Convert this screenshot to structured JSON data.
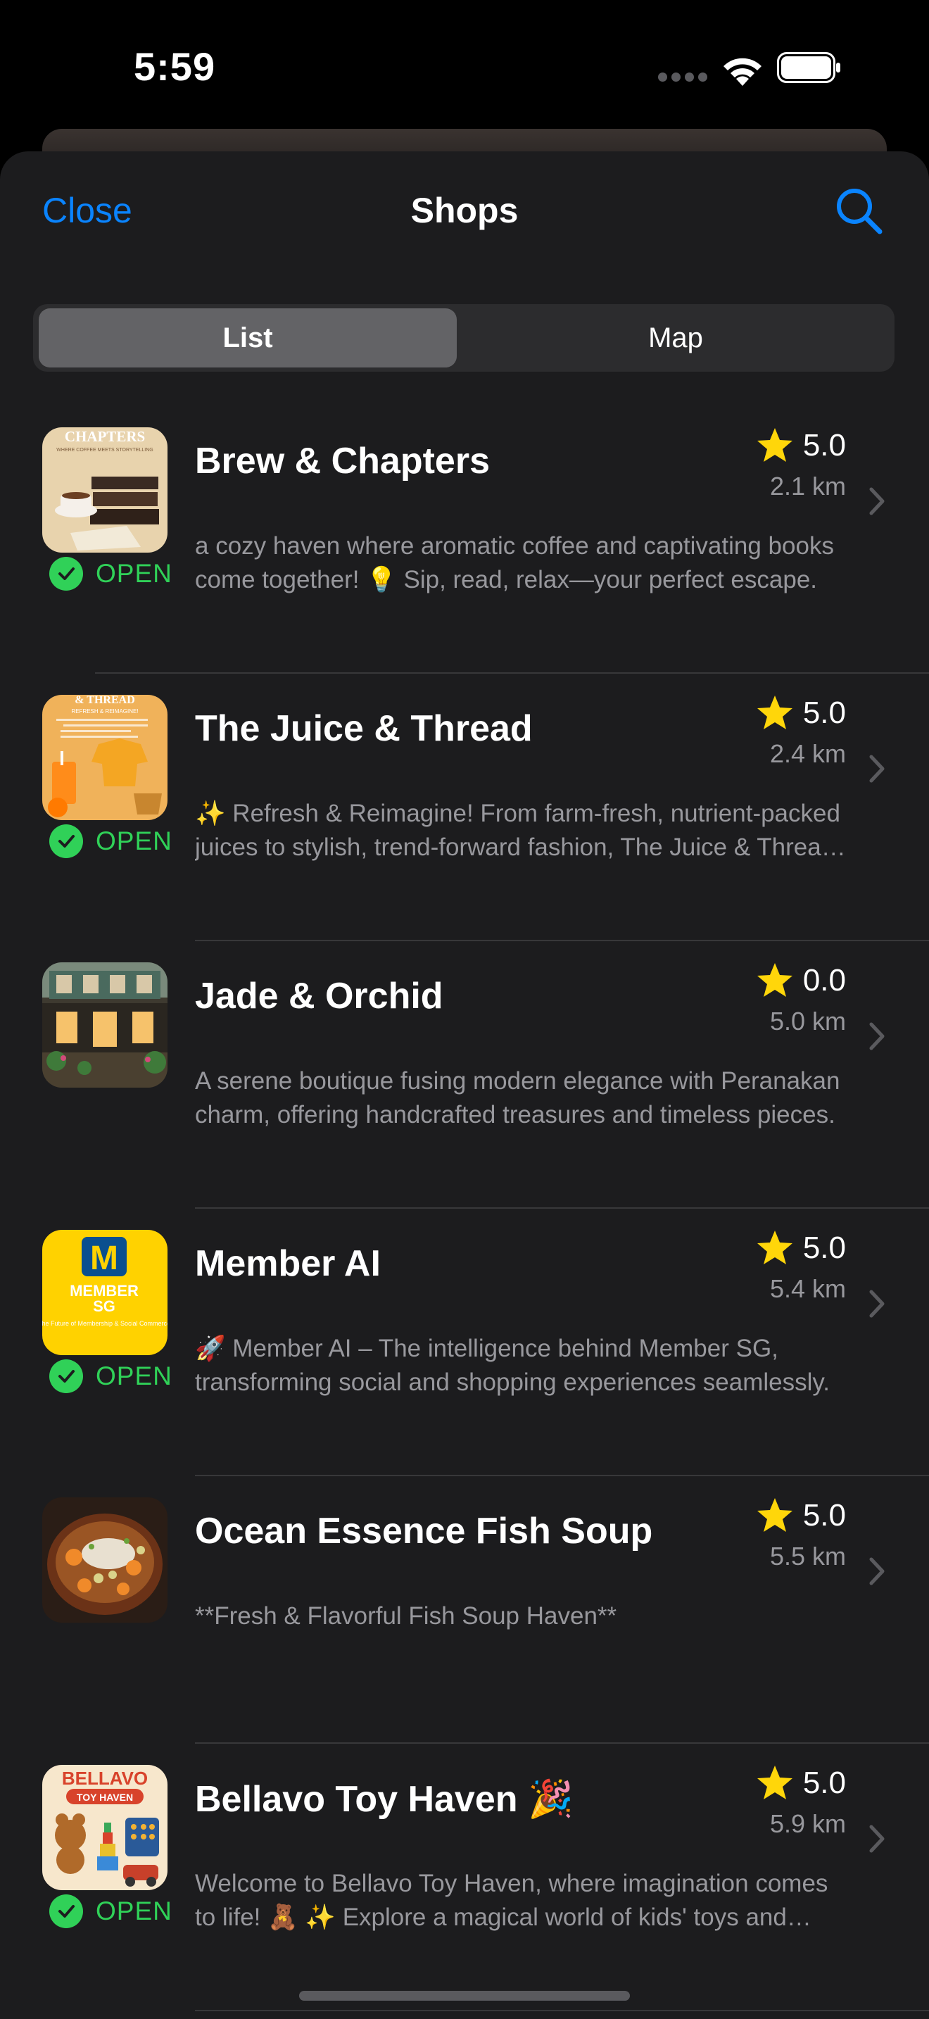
{
  "status": {
    "time": "5:59"
  },
  "nav": {
    "close_label": "Close",
    "title": "Shops"
  },
  "segments": {
    "list_label": "List",
    "map_label": "Map"
  },
  "colors": {
    "accent": "#0a84ff",
    "open": "#30d158",
    "star": "#ffd60a"
  },
  "shops": [
    {
      "name": "Brew & Chapters",
      "rating": "5.0",
      "distance": "2.1 km",
      "open": true,
      "open_label": "OPEN",
      "description": "a cozy haven where aromatic coffee and captivating books come together! 💡 Sip, read, relax—your perfect escape.",
      "thumb_text": [
        "CHAPTERS",
        "WHERE COFFEE MEETS STORYTELLING"
      ]
    },
    {
      "name": "The Juice & Thread",
      "rating": "5.0",
      "distance": "2.4 km",
      "open": true,
      "open_label": "OPEN",
      "description": "✨ Refresh & Reimagine! From farm-fresh, nutrient-packed juices to stylish, trend-forward fashion, The Juice & Thread has it all.",
      "thumb_text": [
        "& THREAD",
        "REFRESH & REIMAGINE!"
      ]
    },
    {
      "name": "Jade & Orchid",
      "rating": "0.0",
      "distance": "5.0 km",
      "open": false,
      "open_label": "",
      "description": "A serene boutique fusing modern elegance with Peranakan charm, offering handcrafted treasures and timeless pieces.",
      "thumb_text": []
    },
    {
      "name": "Member AI",
      "rating": "5.0",
      "distance": "5.4 km",
      "open": true,
      "open_label": "OPEN",
      "description": "🚀 Member AI – The intelligence behind Member SG, transforming social and shopping experiences seamlessly.",
      "thumb_text": [
        "M",
        "MEMBER",
        "SG",
        "The Future of Membership & Social Commerce"
      ]
    },
    {
      "name": "Ocean Essence Fish Soup",
      "rating": "5.0",
      "distance": "5.5 km",
      "open": false,
      "open_label": "",
      "description": "**Fresh & Flavorful Fish Soup Haven**",
      "thumb_text": []
    },
    {
      "name": "Bellavo Toy Haven 🎉",
      "rating": "5.0",
      "distance": "5.9 km",
      "open": true,
      "open_label": "OPEN",
      "description": "Welcome to Bellavo Toy Haven, where imagination comes to life! 🧸 ✨ Explore a magical world of kids' toys and games.",
      "thumb_text": [
        "BELLAVO",
        "TOY HAVEN"
      ]
    }
  ]
}
